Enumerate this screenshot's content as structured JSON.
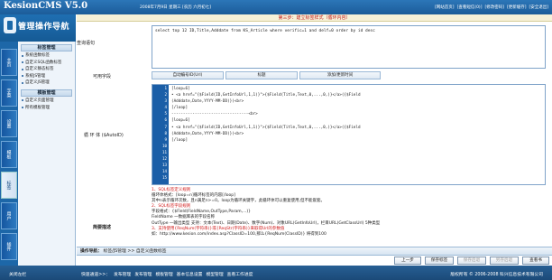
{
  "header": {
    "logo": "KesionCMS V5.0",
    "date": "2008年7月9日 星期三 [农历 六月初七]",
    "links": [
      "[网站首页]",
      "[查看短信(0)]",
      "[修改密码]",
      "[更新缓存]",
      "[安全退出]"
    ]
  },
  "brand": {
    "title": "管理操作导航"
  },
  "vertical_tabs": [
    "主页",
    "字菜",
    "设置",
    "模板",
    "标签",
    "用户",
    "插件"
  ],
  "sidebar": {
    "section1": "标签管理",
    "items1": [
      "系统函数标签",
      "自定义SQL函数标签",
      "自定义静态标签",
      "系统JS管理",
      "自定义JS管理"
    ],
    "section2": "模板管理",
    "items2": [
      "自定义页面管理",
      "所有模板管理"
    ]
  },
  "main": {
    "step": "第三步：建立标签样式（循环内容）",
    "query_label": "查询语句",
    "sql": "select top 12 ID,Title,Adddate from KS_Article where verific=1 and delf=0 order by id desc",
    "fields_label": "可用字段",
    "fields": [
      "自动编号ID(Url)",
      "标题",
      "添加/更新时间"
    ],
    "loop_label": "循 环 体 ($AutoID)",
    "line_numbers": [
      "1",
      "2",
      "3",
      "4",
      "5",
      "6",
      "7",
      "8",
      "9",
      "10",
      "11",
      "12",
      "13",
      "14",
      "15"
    ],
    "code": [
      "[loop=6]",
      "• <a href=\"{$Field(ID,GetInfoUrl,1,1)}\">{$Field(Title,Text,0,...,0,)}</a>({$Field",
      "(Adddate,Date,YYYY-MM-DD)})<br>",
      "[/loop]",
      "---------------------------------<br>",
      "[loop=6]",
      "• <a href=\"{$Field(ID,GetInfoUrl,1,1)}\">{$Field(Title,Text,0,...,0,)}</a>({$Field",
      "(Adddate,Date,YYYY-MM-DD)})<br>",
      "[/loop]",
      "",
      "",
      "",
      "",
      "",
      ""
    ],
    "desc_label": "简要描述",
    "desc": [
      "1、SQL标签定义规则",
      "循环体格式：[loop=n]循环标签的内容[/loop]",
      "其中n表示循环次数，且n满足n>=0。loop为循环关键字，此循环体可以重复使用,但不能嵌套。",
      "2、SQL标签字段规则",
      "字段格式：{$Field(FieldName,OutType,Param,...)}",
      "FieldName  一数据库表的字段名称",
      "OutType  一输出类型 支持：文本(Text)、日期(Date)、数字(Num)、对象URL(GetInfoUrl)，栏目URL(GetClassUrl) 5种类型",
      "3、支持使用{ReqNum(字符串)}或{ReqStr(字符串)}来取得Url的参数值",
      "如：http://www.kesion.com/index.asp?ClassID=100,那么{ReqNum(ClassID)} 将得到100"
    ],
    "op_nav_label": "操作导航：",
    "op_nav_path": "标签/JS管理 >> 自定义函数标签",
    "buttons": [
      "上一步",
      "保存标签",
      "保存后退",
      "另存后退",
      "查看书"
    ]
  },
  "status": {
    "close": "关闭左栏",
    "quick": [
      "快速通道>>：",
      "发布管理",
      "发布管理",
      "模板管理",
      "基本信息设置",
      "模型管理",
      "查看工作进度"
    ],
    "copyright": "版权所有 © 2006-2008 科兴信息技术有限公司"
  }
}
